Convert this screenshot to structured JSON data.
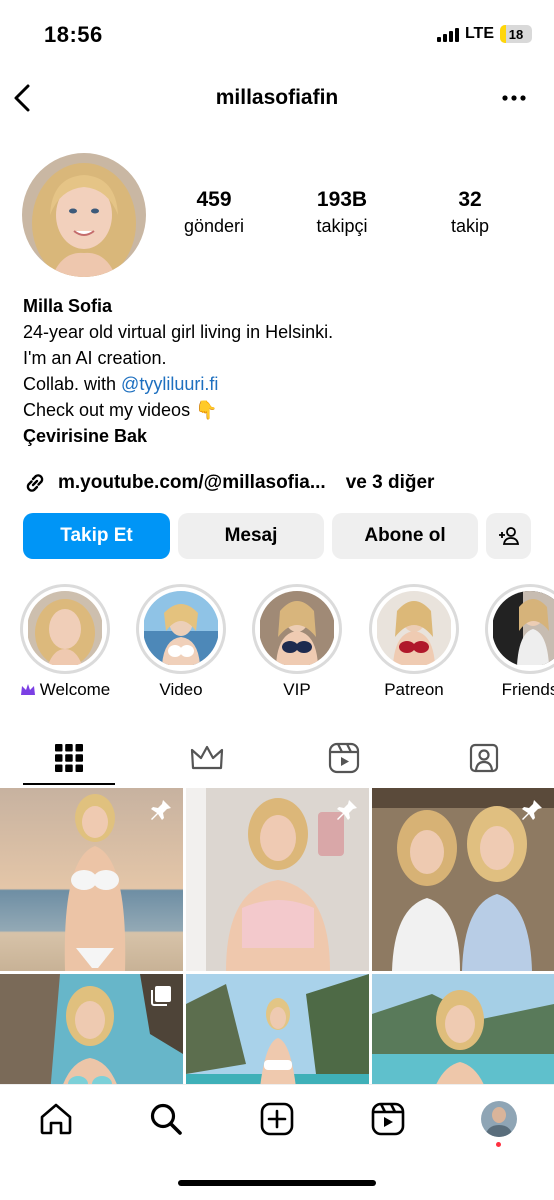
{
  "status_bar": {
    "time": "18:56",
    "network": "LTE",
    "battery": "18",
    "battery_level": 0.18
  },
  "header": {
    "username": "millasofiafin"
  },
  "profile": {
    "stats": [
      {
        "value": "459",
        "label": "gönderi"
      },
      {
        "value": "193B",
        "label": "takipçi"
      },
      {
        "value": "32",
        "label": "takip"
      }
    ],
    "name": "Milla Sofia",
    "bio_lines": [
      "24-year old virtual girl living in Helsinki.",
      "I'm an AI creation."
    ],
    "collab_prefix": "Collab. with ",
    "collab_mention": "@tyyliluuri.fi",
    "videos_line": "Check out my videos",
    "videos_emoji": "👇",
    "translate": "Çevirisine Bak",
    "link": "m.youtube.com/@millasofia...",
    "more_links": "ve 3 diğer"
  },
  "buttons": {
    "follow": "Takip Et",
    "message": "Mesaj",
    "subscribe": "Abone ol"
  },
  "highlights": [
    {
      "label": "Welcome",
      "crown": true
    },
    {
      "label": "Video"
    },
    {
      "label": "VIP"
    },
    {
      "label": "Patreon"
    },
    {
      "label": "Friends"
    }
  ],
  "tabs": [
    "grid-icon",
    "crown-icon",
    "reels-icon",
    "tagged-icon"
  ],
  "colors": {
    "accent": "#0095f6",
    "mention": "#1d6fbf",
    "crown": "#7b3fe4",
    "notification": "#ff3040"
  }
}
